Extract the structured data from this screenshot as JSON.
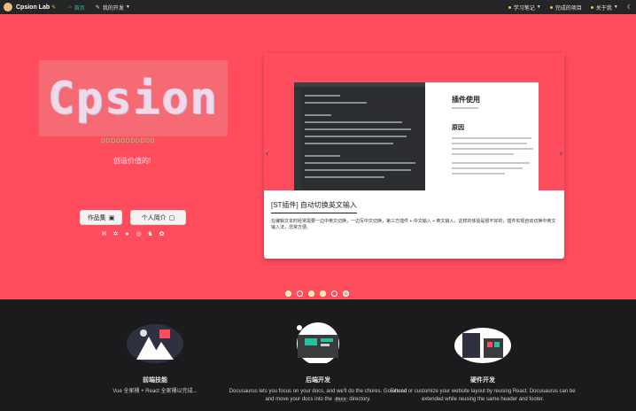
{
  "navbar": {
    "brand": "Cpsion Lab",
    "brand_tail": "✎",
    "items": [
      {
        "label": "首页",
        "icon": "home-icon"
      },
      {
        "label": "我的开发",
        "icon": "pen-icon"
      }
    ],
    "right_items": [
      {
        "label": "学习笔记"
      },
      {
        "label": "完成的项目"
      },
      {
        "label": "关于我"
      }
    ],
    "theme_toggle": "☾"
  },
  "hero": {
    "title": "Cpsion",
    "subtitle": "DDDDDDDDDDD",
    "slogan": "创造价值的!",
    "buttons": [
      {
        "label": "作品集",
        "icon": "📦"
      },
      {
        "label": "个人简介",
        "icon": "📄"
      }
    ],
    "social_icons": [
      "mail-icon",
      "settings-icon",
      "github-icon",
      "dribbble-icon",
      "qq-icon",
      "wechat-icon"
    ]
  },
  "carousel": {
    "preview_heading": "插件使用",
    "preview_subheading": "原因",
    "caption_title": "[ST插件] 自动切换英文输入",
    "caption_text": "在编辑文本时经常需要一边中英文切换，一边写中文切换，第三方插件 + 中文输入 + 英文输入，这样的体验是很不好的，插件实现自动切换中英文输入法，非常方便。",
    "dots": [
      "#fff176",
      "#ff4d5e",
      "#fff176",
      "#fff176",
      "#ff4d5e",
      "#a5d6a7"
    ]
  },
  "features": [
    {
      "title": "前端技能",
      "desc": "Vue 全家桶 + React 全家桶以完成..."
    },
    {
      "title": "后端开发",
      "desc": "Docusaurus lets you focus on your docs, and we'll do the chores. Go ahead and move your docs into the",
      "chip": "docs",
      "desc_end": "directory."
    },
    {
      "title": "硬件开发",
      "desc": "Extend or customize your website layout by reusing React. Docusaurus can be extended while reusing the same header and footer."
    }
  ],
  "colors": {
    "hero_bg": "#ff4d5e",
    "nav_bg": "#242526",
    "accent": "#25c2a0"
  }
}
